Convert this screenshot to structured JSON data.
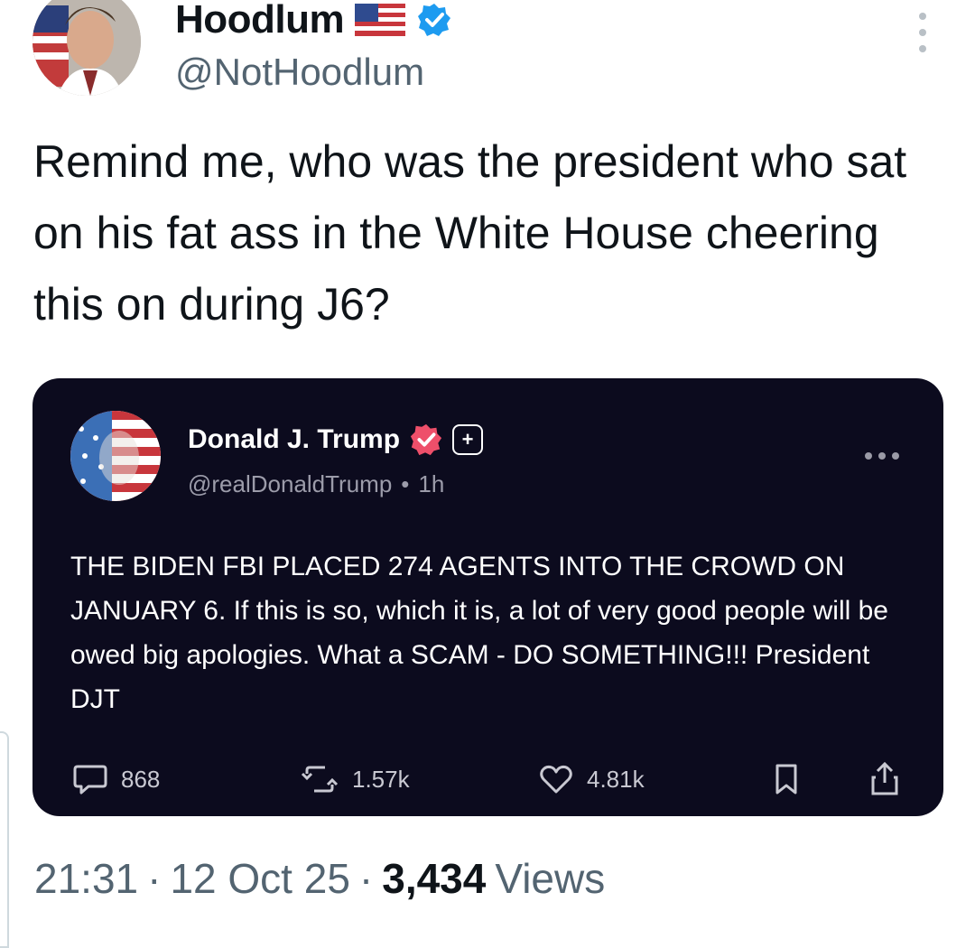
{
  "author": {
    "display_name": "Hoodlum",
    "flag_emoji": "🇺🇸",
    "handle": "@NotHoodlum",
    "verified_color": "#1d9bf0"
  },
  "tweet": {
    "text": "Remind me, who was the president who sat on his fat ass in the White House cheering this on during J6?"
  },
  "embed": {
    "display_name": "Donald J. Trump",
    "handle": "@realDonaldTrump",
    "separator": "•",
    "time": "1h",
    "body": "THE BIDEN FBI PLACED 274 AGENTS INTO THE CROWD ON JANUARY 6. If this is so, which it is, a lot of very good people will be owed big apologies. What a SCAM - DO SOMETHING!!! President DJT",
    "verified_color": "#ee4f6a",
    "background": "#0c0b1e",
    "actions": {
      "replies": "868",
      "reposts": "1.57k",
      "likes": "4.81k"
    }
  },
  "meta": {
    "time": "21:31",
    "dot1": "·",
    "date": "12 Oct 25",
    "dot2": "·",
    "views_count": "3,434",
    "views_label": "Views"
  }
}
